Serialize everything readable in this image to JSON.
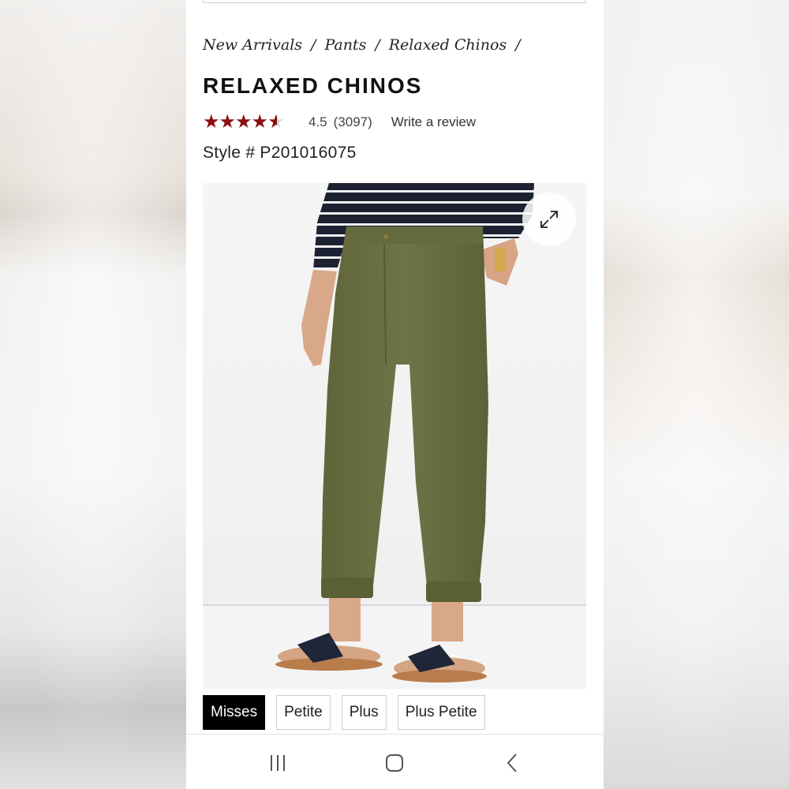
{
  "breadcrumb": {
    "items": [
      "New Arrivals",
      "Pants",
      "Relaxed Chinos"
    ],
    "separator": "/"
  },
  "product": {
    "title": "RELAXED CHINOS",
    "rating_value": "4.5",
    "rating_fraction": 0.9,
    "review_count": "(3097)",
    "write_review_label": "Write a review",
    "style_number": "Style # P201016075",
    "image_alt": "Relaxed chinos in olive green"
  },
  "size_tabs": [
    {
      "label": "Misses",
      "active": true
    },
    {
      "label": "Petite",
      "active": false
    },
    {
      "label": "Plus",
      "active": false
    },
    {
      "label": "Plus Petite",
      "active": false
    }
  ],
  "icons": {
    "expand": "expand-icon",
    "recent_apps": "recent-apps-icon",
    "home": "home-icon",
    "back": "back-icon",
    "star": "star-icon"
  },
  "colors": {
    "star": "#8b0f0f",
    "pants": "#6b7143",
    "active_tab_bg": "#000000"
  }
}
